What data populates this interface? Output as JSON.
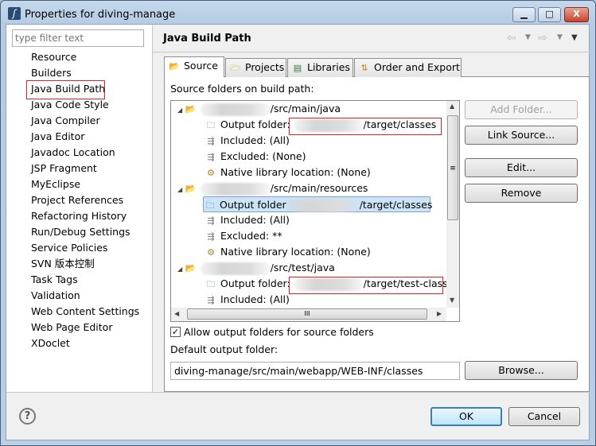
{
  "window": {
    "title": "Properties for diving-manage",
    "min": "▁",
    "max": "□",
    "close": "X"
  },
  "filter": {
    "placeholder": "type filter text"
  },
  "nav": [
    "Resource",
    "Builders",
    "Java Build Path",
    "Java Code Style",
    "Java Compiler",
    "Java Editor",
    "Javadoc Location",
    "JSP Fragment",
    "MyEclipse",
    "Project References",
    "Refactoring History",
    "Run/Debug Settings",
    "Service Policies",
    "SVN 版本控制",
    "Task Tags",
    "Validation",
    "Web Content Settings",
    "Web Page Editor",
    "XDoclet"
  ],
  "nav_selected": "Java Build Path",
  "header": {
    "title": "Java Build Path"
  },
  "tabs": [
    "Source",
    "Projects",
    "Libraries",
    "Order and Export"
  ],
  "active_tab": "Source",
  "source": {
    "label": "Source folders on build path:",
    "tree": [
      {
        "text": "/src/main/java",
        "level": 0,
        "icon": "package-folder-icon"
      },
      {
        "text": "Output folder: ",
        "suffix": "/target/classes",
        "level": 1,
        "icon": "output-folder-icon"
      },
      {
        "text": "Included: (All)",
        "level": 1,
        "icon": "included-icon"
      },
      {
        "text": "Excluded: (None)",
        "level": 1,
        "icon": "excluded-icon"
      },
      {
        "text": "Native library location: (None)",
        "level": 1,
        "icon": "native-library-icon"
      },
      {
        "text": "/src/main/resources",
        "level": 0,
        "icon": "package-folder-icon"
      },
      {
        "text": "Output folder",
        "suffix": "/target/classes",
        "level": 1,
        "icon": "output-folder-icon"
      },
      {
        "text": "Included: (All)",
        "level": 1,
        "icon": "included-icon"
      },
      {
        "text": "Excluded: **",
        "level": 1,
        "icon": "excluded-icon"
      },
      {
        "text": "Native library location: (None)",
        "level": 1,
        "icon": "native-library-icon"
      },
      {
        "text": "/src/test/java",
        "level": 0,
        "icon": "package-folder-icon"
      },
      {
        "text": "Output folder: ",
        "suffix": "/target/test-classe",
        "level": 1,
        "icon": "output-folder-icon"
      },
      {
        "text": "Included: (All)",
        "level": 1,
        "icon": "included-icon"
      }
    ],
    "buttons": {
      "add": "Add Folder...",
      "link": "Link Source...",
      "edit": "Edit...",
      "remove": "Remove"
    },
    "allow_output": {
      "label": "Allow output folders for source folders",
      "checked": true
    },
    "default_output_label": "Default output folder:",
    "default_output_value": "diving-manage/src/main/webapp/WEB-INF/classes",
    "browse": "Browse..."
  },
  "footer": {
    "help": "?",
    "ok": "OK",
    "cancel": "Cancel"
  },
  "colors": {
    "highlight_box": "#e02020",
    "selection": "#cce4f7"
  }
}
